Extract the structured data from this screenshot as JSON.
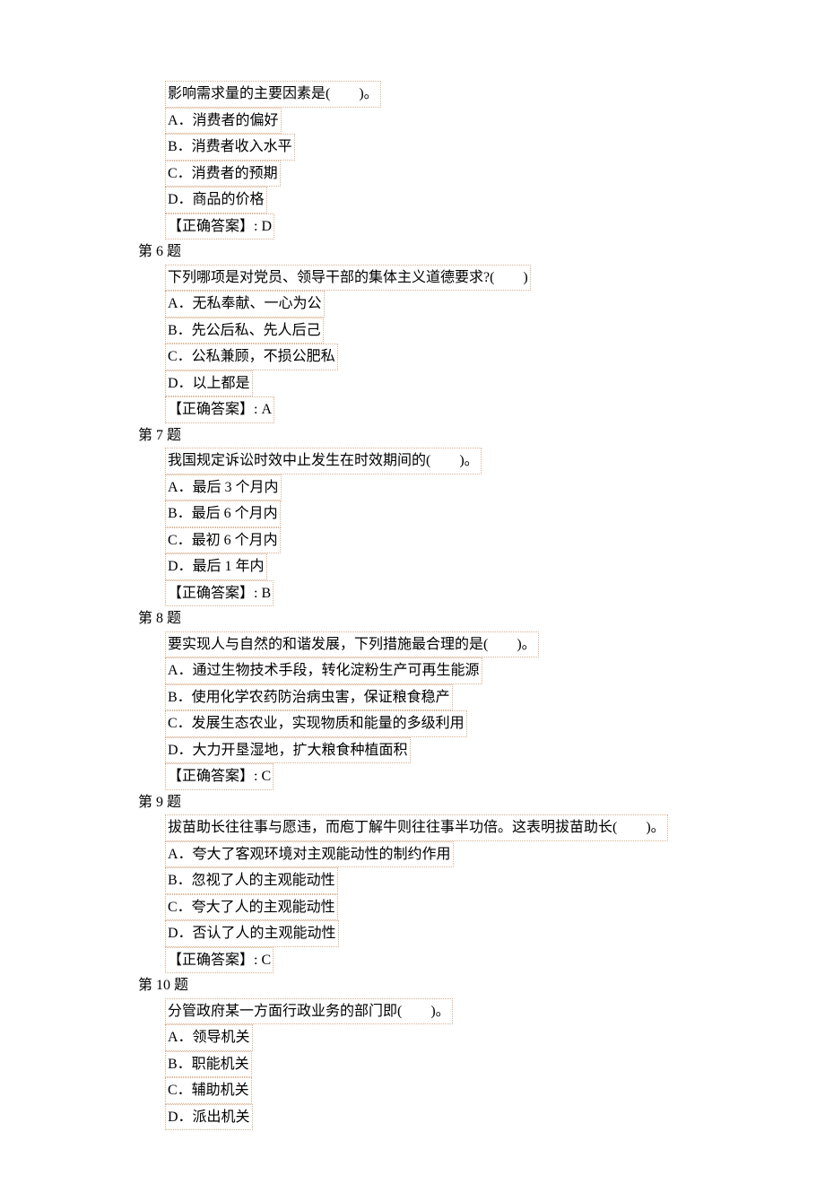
{
  "lines": [
    {
      "text": "影响需求量的主要因素是(　　)。",
      "boxed": true
    },
    {
      "text": "A．消费者的偏好",
      "boxed": true
    },
    {
      "text": "B．消费者收入水平",
      "boxed": true
    },
    {
      "text": "C．消费者的预期",
      "boxed": true
    },
    {
      "text": "D．商品的价格",
      "boxed": true
    },
    {
      "text": "【正确答案】: D",
      "boxed": true
    },
    {
      "text": "第 6 题",
      "boxed": false,
      "nomarg": true
    },
    {
      "text": "下列哪项是对党员、领导干部的集体主义道德要求?(　　)",
      "boxed": true
    },
    {
      "text": "A．无私奉献、一心为公",
      "boxed": true
    },
    {
      "text": "B．先公后私、先人后己",
      "boxed": true
    },
    {
      "text": "C．公私兼顾，不损公肥私",
      "boxed": true
    },
    {
      "text": "D．以上都是",
      "boxed": true
    },
    {
      "text": "【正确答案】: A",
      "boxed": true
    },
    {
      "text": "第 7 题",
      "boxed": false,
      "nomarg": true
    },
    {
      "text": "我国规定诉讼时效中止发生在时效期间的(　　)。",
      "boxed": true
    },
    {
      "text": "A．最后 3 个月内",
      "boxed": true
    },
    {
      "text": "B．最后 6 个月内",
      "boxed": true
    },
    {
      "text": "C．最初 6 个月内",
      "boxed": true
    },
    {
      "text": "D．最后 1 年内",
      "boxed": true
    },
    {
      "text": "【正确答案】: B",
      "boxed": true
    },
    {
      "text": "第 8 题",
      "boxed": false,
      "nomarg": true
    },
    {
      "text": "要实现人与自然的和谐发展，下列措施最合理的是(　　)。",
      "boxed": true
    },
    {
      "text": "A．通过生物技术手段，转化淀粉生产可再生能源",
      "boxed": true
    },
    {
      "text": "B．使用化学农药防治病虫害，保证粮食稳产",
      "boxed": true
    },
    {
      "text": "C．发展生态农业，实现物质和能量的多级利用",
      "boxed": true
    },
    {
      "text": "D．大力开垦湿地，扩大粮食种植面积",
      "boxed": true
    },
    {
      "text": "【正确答案】: C",
      "boxed": true
    },
    {
      "text": "第 9 题",
      "boxed": false,
      "nomarg": true
    },
    {
      "text": "拔苗助长往往事与愿违，而庖丁解牛则往往事半功倍。这表明拔苗助长(　　)。",
      "boxed": true
    },
    {
      "text": "A．夸大了客观环境对主观能动性的制约作用",
      "boxed": true
    },
    {
      "text": "B．忽视了人的主观能动性",
      "boxed": true
    },
    {
      "text": "C．夸大了人的主观能动性",
      "boxed": true
    },
    {
      "text": "D．否认了人的主观能动性",
      "boxed": true
    },
    {
      "text": "【正确答案】: C",
      "boxed": true
    },
    {
      "text": "第 10 题",
      "boxed": false,
      "nomarg": true
    },
    {
      "text": "分管政府某一方面行政业务的部门即(　　)。",
      "boxed": true
    },
    {
      "text": "A．领导机关",
      "boxed": true
    },
    {
      "text": "B．职能机关",
      "boxed": true
    },
    {
      "text": "C．辅助机关",
      "boxed": true
    },
    {
      "text": "D．派出机关",
      "boxed": true
    }
  ]
}
